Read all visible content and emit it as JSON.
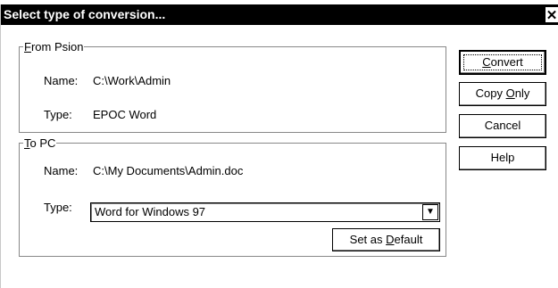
{
  "dialog": {
    "title": "Select type of conversion...",
    "close_glyph": "✕"
  },
  "from_group": {
    "legend_mnemonic": "F",
    "legend_rest": "rom Psion",
    "name_label": "Name:",
    "name_value": "C:\\Work\\Admin",
    "type_label": "Type:",
    "type_value": "EPOC Word"
  },
  "to_group": {
    "legend_mnemonic": "T",
    "legend_rest": "o PC",
    "name_label": "Name:",
    "name_value": "C:\\My Documents\\Admin.doc",
    "type_label": "Type:",
    "type_value": "Word for Windows 97",
    "default_btn_pre": "Set as ",
    "default_btn_mnemonic": "D",
    "default_btn_post": "efault"
  },
  "buttons": {
    "convert_mnemonic": "C",
    "convert_rest": "onvert",
    "copy_pre": "Copy ",
    "copy_mnemonic": "O",
    "copy_post": "nly",
    "cancel": "Cancel",
    "help": "Help"
  },
  "icons": {
    "close": "close-icon",
    "dropdown": "chevron-down-icon"
  }
}
